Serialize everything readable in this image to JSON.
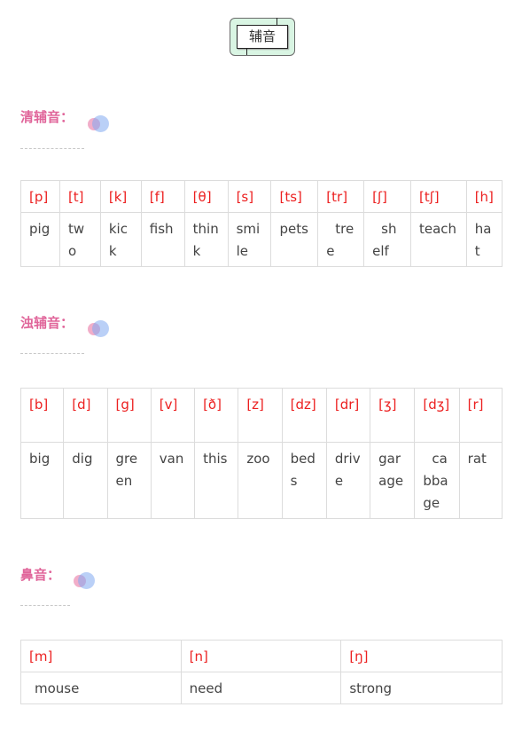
{
  "title": "辅音",
  "sections": [
    {
      "heading": "清辅音：",
      "ipa": [
        "[p]",
        "[t]",
        "[k]",
        "[f]",
        "[θ]",
        "[s]",
        "[ts]",
        "[tr]",
        "[ʃ]",
        "[tʃ]",
        "[h]"
      ],
      "words": [
        "pig",
        "two",
        "kick",
        "fish",
        "think",
        "smile",
        "pets",
        "tree",
        "shelf",
        "teach",
        "hat"
      ]
    },
    {
      "heading": "浊辅音：",
      "ipa": [
        "[b]",
        "[d]",
        "[g]",
        "[v]",
        "[ð]",
        "[z]",
        "[dz]",
        "[dr]",
        "[ʒ]",
        "[dʒ]",
        "[r]"
      ],
      "words": [
        "big",
        "dig",
        "green",
        "van",
        "this",
        "zoo",
        "beds",
        "drive",
        "garage",
        "cabbage",
        "rat"
      ]
    },
    {
      "heading": "鼻音：",
      "ipa": [
        "[m]",
        "[n]",
        "[ŋ]"
      ],
      "words": [
        "mouse",
        "need",
        "strong"
      ]
    }
  ]
}
